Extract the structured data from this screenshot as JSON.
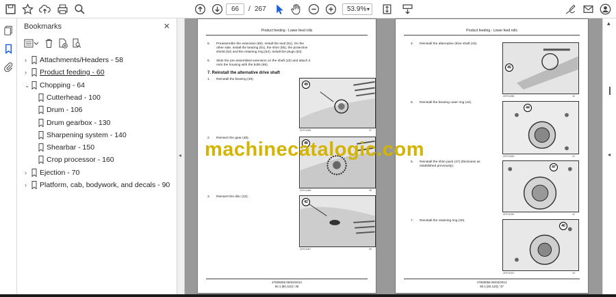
{
  "toolbar": {
    "page_current": "66",
    "page_separator": "/",
    "page_total": "267",
    "zoom": "53.9%"
  },
  "bookmarks": {
    "title": "Bookmarks",
    "close": "×",
    "items": [
      {
        "label": "Attachments/Headers - 58",
        "expanded": false,
        "level": 0
      },
      {
        "label": "Product feeding - 60",
        "expanded": false,
        "level": 0
      },
      {
        "label": "Chopping - 64",
        "expanded": true,
        "level": 0
      },
      {
        "label": "Cutterhead - 100",
        "level": 1
      },
      {
        "label": "Drum - 106",
        "level": 1
      },
      {
        "label": "Drum gearbox - 130",
        "level": 1
      },
      {
        "label": "Sharpening system - 140",
        "level": 1
      },
      {
        "label": "Shearbar - 150",
        "level": 1
      },
      {
        "label": "Crop processor - 160",
        "level": 1
      },
      {
        "label": "Ejection - 70",
        "expanded": false,
        "level": 0
      },
      {
        "label": "Platform, cab, bodywork, and decals - 90",
        "expanded": false,
        "level": 0
      }
    ]
  },
  "left_page": {
    "header": "Product feeding - Lower feed rolls",
    "steps_top": [
      {
        "num": "5.",
        "text": "Preassemble the extension (65). Install the seal (61). On the other side, install the bearing (51), the shim (55), the protective shield (52) and the retaining ring (54). Install the plugs (53)."
      },
      {
        "num": "6.",
        "text": "Slide the pre-assembled extension on the shaft (10) and attach it onto the housing with the bolts (65)."
      }
    ],
    "section": "7. Reinstall the alternative drive shaft",
    "steps": [
      {
        "num": "1.",
        "text": "Reinstall the bearing (49).",
        "callout": "49",
        "code": "ZDF11085",
        "ref": "37"
      },
      {
        "num": "2.",
        "text": "Reinsert the gear (48).",
        "callout": "48",
        "code": "ZDF11086",
        "ref": "38"
      },
      {
        "num": "3.",
        "text": "Reinsert the disc (42).",
        "callout": "42",
        "code": "ZDF11087",
        "ref": "39"
      }
    ],
    "footer_line1": "47605056 06/02/2014",
    "footer_line2": "60.1 [60.110] / 36"
  },
  "right_page": {
    "header": "Product feeding - Lower feed rolls",
    "steps": [
      {
        "num": "4.",
        "text": "Reinstall the alternative drive shaft (43).",
        "callout": "45",
        "code": "ZDF11088",
        "ref": "40"
      },
      {
        "num": "5.",
        "text": "Reinstall the bearing outer ring (44).",
        "callout": "44",
        "code": "ZDF11089",
        "ref": "41"
      },
      {
        "num": "6.",
        "text": "Reinstall the shim pack (47) (thickness as established previously).",
        "callout": "47",
        "code": "ZDF11090",
        "ref": "42"
      },
      {
        "num": "7.",
        "text": "Reinstall the retaining ring (40).",
        "callout": "40",
        "code": "ZDF11091",
        "ref": "43"
      }
    ],
    "footer_line1": "47605056 06/02/2014",
    "footer_line2": "60.1 [60.110] / 37"
  },
  "watermark": "machinecatalogic.com",
  "colors": {
    "watermark": "#d4b400",
    "viewer_bg": "#999999"
  }
}
